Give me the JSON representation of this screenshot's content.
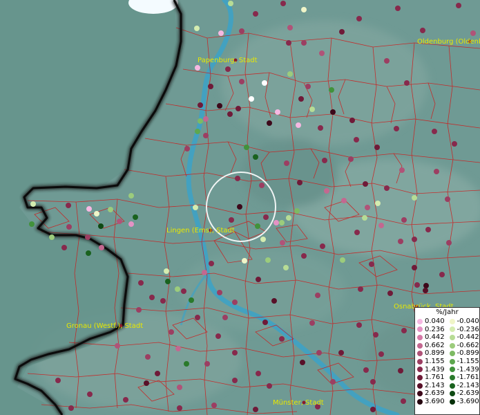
{
  "cities": [
    {
      "name": "Papenburg, Stadt",
      "dot": "#8b1a2a"
    },
    {
      "name": "Oldenburg (Oldenburg)",
      "dot": "#8b1a2a"
    },
    {
      "name": "Lingen (Ems), Stadt",
      "dot": "#8b1a2a"
    },
    {
      "name": "Gronau (Westf.), Stadt",
      "dot": "#8b1a2a"
    },
    {
      "name": "Osnabrück, Stadt",
      "dot": "#8b1a2a"
    },
    {
      "name": "Münster, Stadt",
      "dot": "#8b1a2a"
    }
  ],
  "legend": {
    "title": "%/Jahr",
    "rows": [
      {
        "pos": "0.040",
        "pos_color": "#f6b8e2",
        "neg": "-0.040",
        "neg_color": "#f0f5c8"
      },
      {
        "pos": "0.236",
        "pos_color": "#e592c5",
        "neg": "-0.236",
        "neg_color": "#d4ecb0"
      },
      {
        "pos": "0.442",
        "pos_color": "#d67aa8",
        "neg": "-0.442",
        "neg_color": "#b7dc95"
      },
      {
        "pos": "0.662",
        "pos_color": "#c36890",
        "neg": "-0.662",
        "neg_color": "#9ccc7c"
      },
      {
        "pos": "0.899",
        "pos_color": "#b05378",
        "neg": "-0.899",
        "neg_color": "#7dba63"
      },
      {
        "pos": "1.155",
        "pos_color": "#9c3e62",
        "neg": "-1.155",
        "neg_color": "#5ea74e"
      },
      {
        "pos": "1.439",
        "pos_color": "#87294c",
        "neg": "-1.439",
        "neg_color": "#41923b"
      },
      {
        "pos": "1.761",
        "pos_color": "#6f1a38",
        "neg": "-1.761",
        "neg_color": "#2a7a2b"
      },
      {
        "pos": "2.143",
        "pos_color": "#581028",
        "neg": "-2.143",
        "neg_color": "#19621e"
      },
      {
        "pos": "2.639",
        "pos_color": "#3d081a",
        "neg": "-2.639",
        "neg_color": "#0e4a13"
      },
      {
        "pos": "3.690",
        "pos_color": "#24040e",
        "neg": "-3.690",
        "neg_color": "#06300a"
      }
    ]
  },
  "colors": {
    "background": "#6f9a94",
    "border_lines": "#d01818",
    "river": "#3ea2c4",
    "national_border": "#1a1a1a",
    "city_label": "#e8e800",
    "highlight_circle": "#ffffff"
  }
}
